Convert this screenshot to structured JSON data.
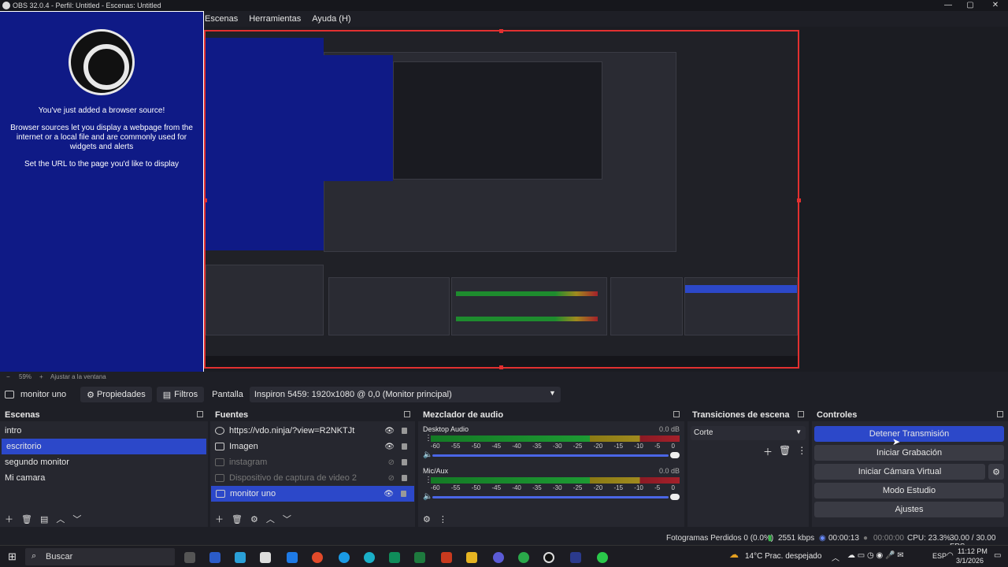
{
  "window": {
    "title": "OBS 32.0.4 - Perfil: Untitled - Escenas: Untitled",
    "min": "—",
    "max": "▢",
    "close": "✕"
  },
  "menu": [
    "Escenas",
    "Herramientas",
    "Ayuda (H)"
  ],
  "browser_source": {
    "heading": "You've just added a browser source!",
    "body": "Browser sources let you display a webpage from the internet or a local file and are commonly used for widgets and alerts",
    "hint": "Set the URL to the page you'd like to display"
  },
  "zoom": {
    "percent": "59%",
    "fit": "Ajustar a la ventana"
  },
  "toolbar": {
    "source_name": "monitor uno",
    "properties": "Propiedades",
    "filters": "Filtros",
    "display_label": "Pantalla",
    "display_value": "Inspiron 5459: 1920x1080 @ 0,0 (Monitor principal)"
  },
  "scenes": {
    "title": "Escenas",
    "items": [
      {
        "label": "intro",
        "selected": false
      },
      {
        "label": "escritorio",
        "selected": true
      },
      {
        "label": "segundo monitor",
        "selected": false
      },
      {
        "label": "Mi camara",
        "selected": false
      }
    ]
  },
  "sources": {
    "title": "Fuentes",
    "items": [
      {
        "label": "https://vdo.ninja/?view=R2NKTJt",
        "icon": "globe-icon",
        "visible": true,
        "selected": false
      },
      {
        "label": "Imagen",
        "icon": "image-icon",
        "visible": true,
        "selected": false
      },
      {
        "label": "instagram",
        "icon": "group-icon",
        "visible": false,
        "selected": false
      },
      {
        "label": "Dispositivo de captura de video 2",
        "icon": "camera-icon",
        "visible": false,
        "selected": false
      },
      {
        "label": "monitor uno",
        "icon": "monitor-icon",
        "visible": true,
        "selected": true
      }
    ]
  },
  "mixer": {
    "title": "Mezclador de audio",
    "ticks": [
      "-60",
      "-55",
      "-50",
      "-45",
      "-40",
      "-35",
      "-30",
      "-25",
      "-20",
      "-15",
      "-10",
      "-5",
      "0"
    ],
    "channels": [
      {
        "name": "Desktop Audio",
        "db": "0.0 dB",
        "volume": 1.0
      },
      {
        "name": "Mic/Aux",
        "db": "0.0 dB",
        "volume": 1.0
      }
    ]
  },
  "transitions": {
    "title": "Transiciones de escena",
    "current": "Corte"
  },
  "controls": {
    "title": "Controles",
    "buttons": [
      "Detener Transmisión",
      "Iniciar Grabación",
      "Iniciar Cámara Virtual",
      "Modo Estudio",
      "Ajustes"
    ]
  },
  "status": {
    "frames": "Fotogramas Perdidos 0 (0.0%)",
    "bitrate": "2551 kbps",
    "stream_time": "00:00:13",
    "rec_time": "00:00:00",
    "cpu": "CPU: 23.3%",
    "fps": "30.00 / 30.00 FPS"
  },
  "taskbar": {
    "search": "Buscar",
    "weather": "14°C  Prac. despejado",
    "lang": "ESP",
    "time": "11:12 PM",
    "date": "3/1/2026"
  },
  "colors": {
    "accent": "#2c48c9",
    "recording_border": "#e23030",
    "browser_bg": "#0f1a86"
  }
}
